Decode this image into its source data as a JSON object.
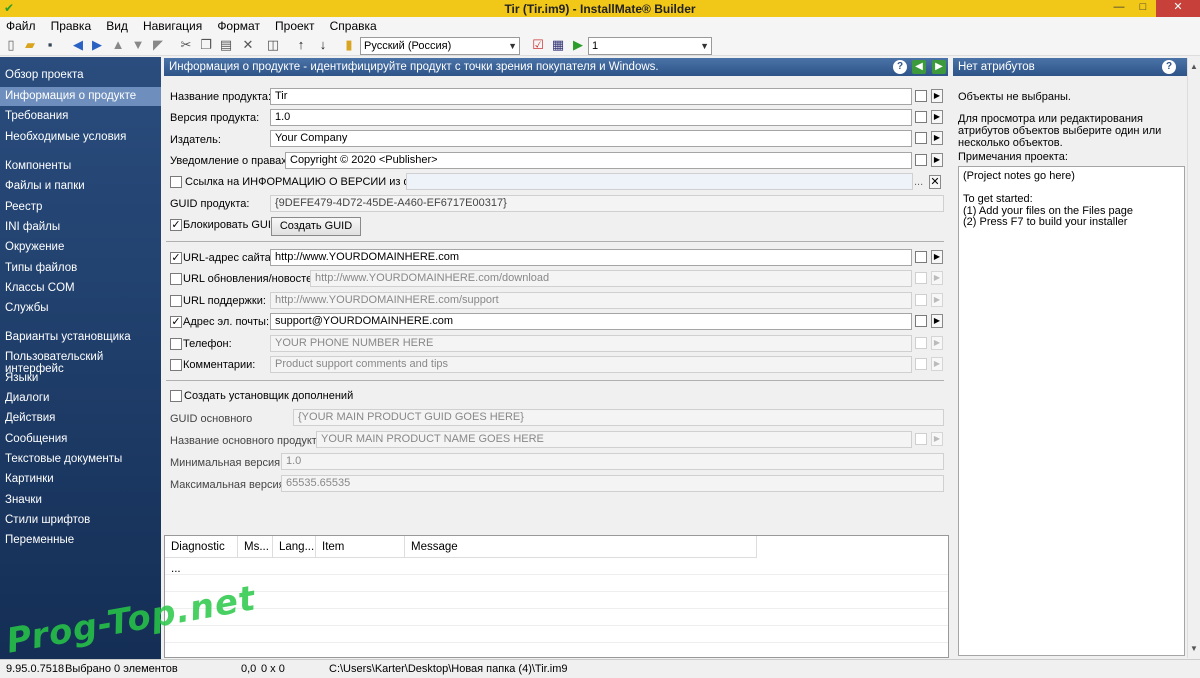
{
  "window": {
    "title": "Tir (Tir.im9) - InstallMate® Builder",
    "min": "—",
    "max": "□",
    "close": "✕"
  },
  "menu": [
    "Файл",
    "Правка",
    "Вид",
    "Навигация",
    "Формат",
    "Проект",
    "Справка"
  ],
  "toolbar": {
    "language": "Русский (Россия)",
    "build": "1"
  },
  "sidebar": {
    "items": [
      "Обзор проекта",
      "Информация о продукте",
      "Требования",
      "Необходимые условия",
      "Компоненты",
      "Файлы и папки",
      "Реестр",
      "INI файлы",
      "Окружение",
      "Типы файлов",
      "Классы COM",
      "Службы",
      "Варианты установщика",
      "Пользовательский интерфейс",
      "Языки",
      "Диалоги",
      "Действия",
      "Сообщения",
      "Текстовые документы",
      "Картинки",
      "Значки",
      "Стили шрифтов",
      "Переменные"
    ],
    "selected": "Информация о продукте"
  },
  "panel": {
    "title": "Информация о продукте - идентифицируйте продукт с точки зрения покупателя и Windows."
  },
  "form": {
    "product_name_label": "Название продукта:",
    "product_name": "Tir",
    "version_label": "Версия продукта:",
    "version": "1.0",
    "publisher_label": "Издатель:",
    "publisher": "Your Company",
    "copyright_label": "Уведомление о правах:",
    "copyright": "Copyright © 2020 <Publisher>",
    "versioninfo_label": "Ссылка на ИНФОРМАЦИЮ О ВЕРСИИ из файла:",
    "versioninfo_browse": "...",
    "versioninfo_clear": "✕",
    "guid_label": "GUID продукта:",
    "guid": "{9DEFE479-4D72-45DE-A460-EF6717E00317}",
    "lock_guid_label": "Блокировать GUID",
    "create_guid_button": "Создать GUID",
    "website_label": "URL-адрес сайта:",
    "website": "http://www.YOURDOMAINHERE.com",
    "update_label": "URL обновления/новостей:",
    "update": "http://www.YOURDOMAINHERE.com/download",
    "support_label": "URL поддержки:",
    "support": "http://www.YOURDOMAINHERE.com/support",
    "email_label": "Адрес эл. почты:",
    "email": "support@YOURDOMAINHERE.com",
    "phone_label": "Телефон:",
    "phone": "YOUR PHONE NUMBER HERE",
    "comments_label": "Комментарии:",
    "comments": "Product support comments and tips",
    "addon_label": "Создать установщик дополнений",
    "main_guid_label": "GUID основного",
    "main_guid": "{YOUR MAIN PRODUCT GUID GOES HERE}",
    "main_name_label": "Название основного продукта:",
    "main_name": "YOUR MAIN PRODUCT NAME GOES HERE",
    "min_version_label": "Минимальная версия:",
    "min_version": "1.0",
    "max_version_label": "Максимальная версия:",
    "max_version": "65535.65535",
    "checkmark": "✓",
    "arrow": "▶"
  },
  "diagnostics": {
    "columns": [
      "Diagnostic ...",
      "Ms...",
      "Lang...",
      "Item",
      "Message"
    ]
  },
  "right_panel": {
    "title": "Нет атрибутов",
    "no_selection": "Объекты не выбраны.",
    "hint": "Для просмотра или редактирования атрибутов объектов выберите один или несколько объектов.",
    "notes_label": "Примечания проекта:",
    "notes": "(Project notes go here)\n\nTo get started:\n(1) Add your files on the Files page\n(2) Press F7 to build your installer"
  },
  "status": {
    "version": "9.95.0.7518",
    "selection": "Выбрано 0 элементов",
    "pos": "0,0",
    "size": "0 x 0",
    "path": "C:\\Users\\Karter\\Desktop\\Новая папка (4)\\Tir.im9"
  },
  "watermark": "Prog-Top.net"
}
